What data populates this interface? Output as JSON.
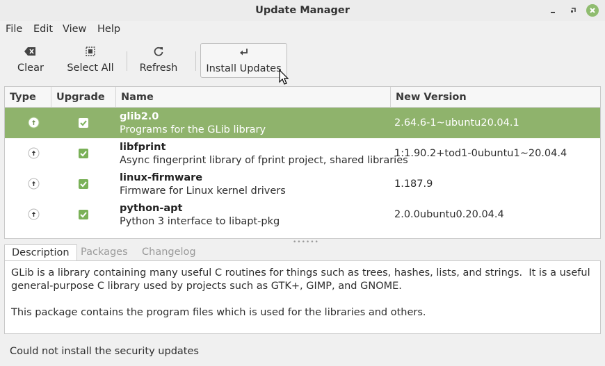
{
  "window": {
    "title": "Update Manager",
    "controls": [
      "minimize-icon",
      "maximize-icon",
      "close-icon"
    ],
    "accent_color": "#8fb36c"
  },
  "menu": {
    "items": [
      "File",
      "Edit",
      "View",
      "Help"
    ]
  },
  "toolbar": {
    "buttons": [
      {
        "label": "Clear",
        "icon": "backspace-icon"
      },
      {
        "label": "Select All",
        "icon": "select-all-icon"
      },
      {
        "label": "Refresh",
        "icon": "refresh-icon"
      },
      {
        "label": "Install Updates",
        "icon": "enter-icon"
      }
    ]
  },
  "table": {
    "columns": [
      "Type",
      "Upgrade",
      "Name",
      "New Version"
    ],
    "rows": [
      {
        "name": "glib2.0",
        "description": "Programs for the GLib library",
        "version": "2.64.6-1~ubuntu20.04.1",
        "checked": true,
        "selected": true
      },
      {
        "name": "libfprint",
        "description": "Async fingerprint library of fprint project, shared libraries",
        "version": "1:1.90.2+tod1-0ubuntu1~20.04.4",
        "checked": true,
        "selected": false
      },
      {
        "name": "linux-firmware",
        "description": "Firmware for Linux kernel drivers",
        "version": "1.187.9",
        "checked": true,
        "selected": false
      },
      {
        "name": "python-apt",
        "description": "Python 3 interface to libapt-pkg",
        "version": "2.0.0ubuntu0.20.04.4",
        "checked": true,
        "selected": false
      }
    ]
  },
  "tabs": {
    "items": [
      "Description",
      "Packages",
      "Changelog"
    ],
    "active": "Description"
  },
  "description": {
    "text": "GLib is a library containing many useful C routines for things such as trees, hashes, lists, and strings.  It is a useful general-purpose C library used by projects such as GTK+, GIMP, and GNOME.\n\nThis package contains the program files which is used for the libraries and others."
  },
  "status": {
    "text": "Could not install the security updates"
  }
}
